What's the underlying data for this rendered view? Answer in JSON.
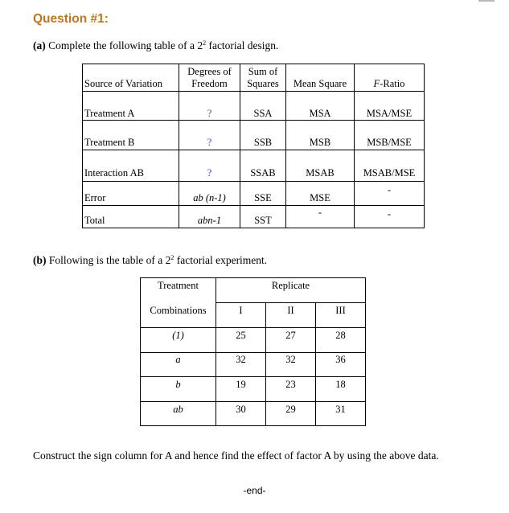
{
  "question_title": "Question #1:",
  "part_a": {
    "label": "(a)",
    "text_before": " Complete the following table of a 2",
    "sup": "2",
    "text_after": " factorial design."
  },
  "anova_table": {
    "headers": {
      "source": "Source of Variation",
      "df_line1": "Degrees of",
      "df_line2": "Freedom",
      "ss_line1": "Sum of",
      "ss_line2": "Squares",
      "ms": "Mean Square",
      "f_italic": "F",
      "f_rest": "-Ratio"
    },
    "rows": [
      {
        "source": "Treatment A",
        "df": "?",
        "ss": "SSA",
        "ms": "MSA",
        "f": "MSA/MSE"
      },
      {
        "source": "Treatment B",
        "df": "?",
        "ss": "SSB",
        "ms": "MSB",
        "f": "MSB/MSE"
      },
      {
        "source": "Interaction AB",
        "df": "?",
        "ss": "SSAB",
        "ms": "MSAB",
        "f": "MSAB/MSE"
      },
      {
        "source": "Error",
        "df": "ab (n-1)",
        "ss": "SSE",
        "ms": "MSE",
        "f": "-"
      },
      {
        "source": "Total",
        "df": "abn-1",
        "ss": "SST",
        "ms": "-",
        "f": "-"
      }
    ]
  },
  "part_b": {
    "label": "(b)",
    "text_before": " Following is the table of a 2",
    "sup": "2",
    "text_after": " factorial experiment."
  },
  "data_table": {
    "header_treatment_line1": "Treatment",
    "header_treatment_line2": "Combinations",
    "header_replicate": "Replicate",
    "replicates": [
      "I",
      "II",
      "III"
    ],
    "rows": [
      {
        "treatment": "(1)",
        "values": [
          "25",
          "27",
          "28"
        ]
      },
      {
        "treatment": "a",
        "values": [
          "32",
          "32",
          "36"
        ]
      },
      {
        "treatment": "b",
        "values": [
          "19",
          "23",
          "18"
        ]
      },
      {
        "treatment": "ab",
        "values": [
          "30",
          "29",
          "31"
        ]
      }
    ]
  },
  "instruction": "Construct the sign column for A and hence find the effect of factor A by using the above data.",
  "end_marker": "-end-",
  "colors": {
    "title": "#c0761a",
    "question_mark": "#4040a0"
  }
}
